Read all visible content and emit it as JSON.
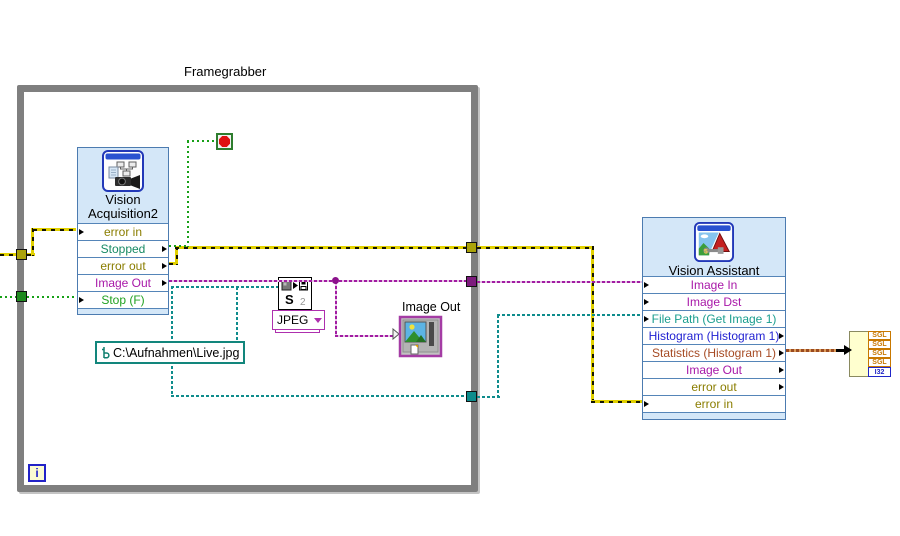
{
  "loop": {
    "label": "Framegrabber"
  },
  "iteration_terminal": {
    "label": "i"
  },
  "vision_acquisition": {
    "title": "Vision Acquisition2",
    "terminals": [
      {
        "label": "error in",
        "color": "#8a7d00"
      },
      {
        "label": "Stopped",
        "color": "#178a64"
      },
      {
        "label": "error out",
        "color": "#8a7d00"
      },
      {
        "label": "Image Out",
        "color": "#a818a8"
      },
      {
        "label": "Stop (F)",
        "color": "#21a121"
      }
    ]
  },
  "jpeg_writer": {
    "format": "JPEG",
    "instance_number": "2"
  },
  "image_display": {
    "label": "Image Out"
  },
  "path_constant": {
    "value": "C:\\Aufnahmen\\Live.jpg"
  },
  "vision_assistant": {
    "title": "Vision Assistant",
    "terminals": [
      {
        "label": "Image In",
        "color": "#a818a8"
      },
      {
        "label": "Image Dst",
        "color": "#a818a8"
      },
      {
        "label": "File Path (Get Image 1)",
        "color": "#1a9e8f"
      },
      {
        "label": "Histogram (Histogram 1)",
        "color": "#2222d2"
      },
      {
        "label": "Statistics (Histogram 1)",
        "color": "#a64b24"
      },
      {
        "label": "Image Out",
        "color": "#a818a8"
      },
      {
        "label": "error out",
        "color": "#8a7d00"
      },
      {
        "label": "error in",
        "color": "#8a7d00"
      }
    ]
  },
  "statistics_cluster": {
    "fields": [
      {
        "label": "SGL",
        "color": "#c87800"
      },
      {
        "label": "SGL",
        "color": "#c87800"
      },
      {
        "label": "SGL",
        "color": "#c87800"
      },
      {
        "label": "SGL",
        "color": "#c87800"
      },
      {
        "label": "I32",
        "color": "#2026c8"
      }
    ]
  },
  "colors": {
    "loop_border": "#7f7f7f",
    "node_background": "#d4e7f8",
    "node_border": "#4c7bb0",
    "error_wire": "#e2d100",
    "image_wire": "#a21ca2",
    "path_wire": "#0e8c8c",
    "boolean_wire": "#17a017",
    "cluster_wire": "#9a4a20",
    "dropdown_accent": "#ae2fae"
  }
}
